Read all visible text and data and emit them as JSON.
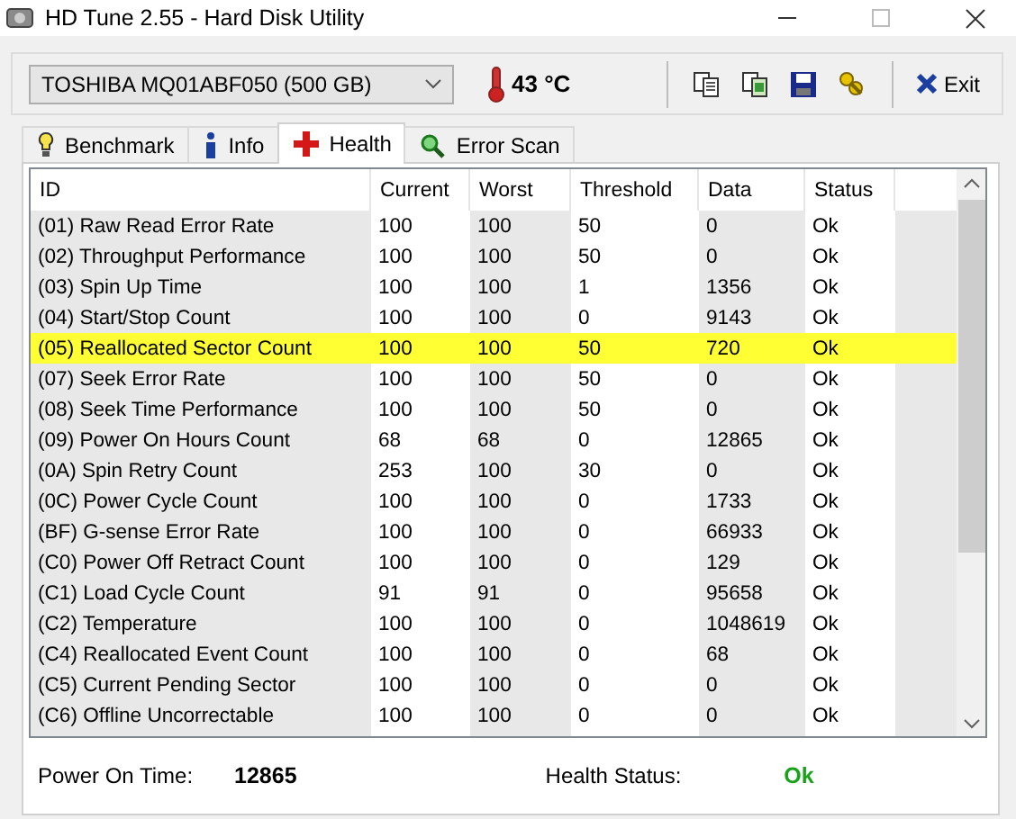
{
  "window": {
    "title": "HD Tune 2.55 - Hard Disk Utility"
  },
  "toolbar": {
    "drive": "TOSHIBA MQ01ABF050 (500 GB)",
    "temperature": "43 °C",
    "exit_label": "Exit"
  },
  "tabs": [
    {
      "label": "Benchmark",
      "kind": "bulb",
      "selected": false
    },
    {
      "label": "Info",
      "kind": "info",
      "selected": false
    },
    {
      "label": "Health",
      "kind": "cross",
      "selected": true
    },
    {
      "label": "Error Scan",
      "kind": "magnifier",
      "selected": false
    }
  ],
  "table": {
    "columns": [
      "ID",
      "Current",
      "Worst",
      "Threshold",
      "Data",
      "Status"
    ],
    "rows": [
      {
        "cells": [
          "(01) Raw Read Error Rate",
          "100",
          "100",
          "50",
          "0",
          "Ok"
        ],
        "highlighted": false
      },
      {
        "cells": [
          "(02) Throughput Performance",
          "100",
          "100",
          "50",
          "0",
          "Ok"
        ],
        "highlighted": false
      },
      {
        "cells": [
          "(03) Spin Up Time",
          "100",
          "100",
          "1",
          "1356",
          "Ok"
        ],
        "highlighted": false
      },
      {
        "cells": [
          "(04) Start/Stop Count",
          "100",
          "100",
          "0",
          "9143",
          "Ok"
        ],
        "highlighted": false
      },
      {
        "cells": [
          "(05) Reallocated Sector Count",
          "100",
          "100",
          "50",
          "720",
          "Ok"
        ],
        "highlighted": true
      },
      {
        "cells": [
          "(07) Seek Error Rate",
          "100",
          "100",
          "50",
          "0",
          "Ok"
        ],
        "highlighted": false
      },
      {
        "cells": [
          "(08) Seek Time Performance",
          "100",
          "100",
          "50",
          "0",
          "Ok"
        ],
        "highlighted": false
      },
      {
        "cells": [
          "(09) Power On Hours Count",
          "68",
          "68",
          "0",
          "12865",
          "Ok"
        ],
        "highlighted": false
      },
      {
        "cells": [
          "(0A) Spin Retry Count",
          "253",
          "100",
          "30",
          "0",
          "Ok"
        ],
        "highlighted": false
      },
      {
        "cells": [
          "(0C) Power Cycle Count",
          "100",
          "100",
          "0",
          "1733",
          "Ok"
        ],
        "highlighted": false
      },
      {
        "cells": [
          "(BF) G-sense Error Rate",
          "100",
          "100",
          "0",
          "66933",
          "Ok"
        ],
        "highlighted": false
      },
      {
        "cells": [
          "(C0) Power Off Retract Count",
          "100",
          "100",
          "0",
          "129",
          "Ok"
        ],
        "highlighted": false
      },
      {
        "cells": [
          "(C1) Load Cycle Count",
          "91",
          "91",
          "0",
          "95658",
          "Ok"
        ],
        "highlighted": false
      },
      {
        "cells": [
          "(C2) Temperature",
          "100",
          "100",
          "0",
          "1048619",
          "Ok"
        ],
        "highlighted": false
      },
      {
        "cells": [
          "(C4) Reallocated Event Count",
          "100",
          "100",
          "0",
          "68",
          "Ok"
        ],
        "highlighted": false
      },
      {
        "cells": [
          "(C5) Current Pending Sector",
          "100",
          "100",
          "0",
          "0",
          "Ok"
        ],
        "highlighted": false
      },
      {
        "cells": [
          "(C6) Offline Uncorrectable",
          "100",
          "100",
          "0",
          "0",
          "Ok"
        ],
        "highlighted": false
      }
    ]
  },
  "footer": {
    "power_on_label": "Power On Time:",
    "power_on_value": "12865",
    "health_label": "Health Status:",
    "health_value": "Ok"
  }
}
